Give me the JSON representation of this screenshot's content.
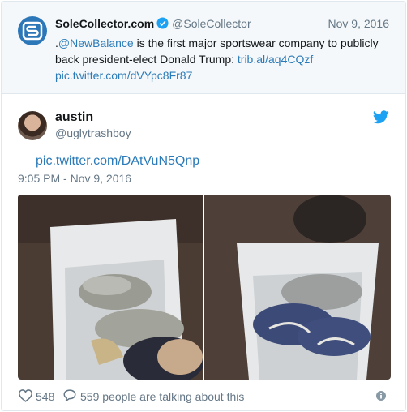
{
  "quoted_tweet": {
    "name": "SoleCollector.com",
    "handle": "@SoleCollector",
    "date": "Nov 9, 2016",
    "text_prefix": ".",
    "mention": "@NewBalance",
    "text_body": " is the first major sportswear company to publicly back president-elect Donald Trump: ",
    "link1": "trib.al/aq4CQzf",
    "link2": "pic.twitter.com/dVYpc8Fr87"
  },
  "tweet": {
    "name": "austin",
    "handle": "@uglytrashboy",
    "pic_link": "pic.twitter.com/DAtVuN5Qnp",
    "timestamp": "9:05 PM - Nov 9, 2016"
  },
  "actions": {
    "like_count": "548",
    "reply_text": "559 people are talking about this"
  },
  "icons": {
    "brand": "solecollector-logo-icon",
    "verified": "verified-badge-icon",
    "twitter": "twitter-bird-icon",
    "like": "heart-icon",
    "reply": "speech-bubble-icon",
    "info": "info-icon"
  },
  "colors": {
    "link": "#2b7bb9",
    "twitter_blue": "#1da1f2",
    "muted": "#657786",
    "quoted_bg": "#f5f8fa"
  }
}
